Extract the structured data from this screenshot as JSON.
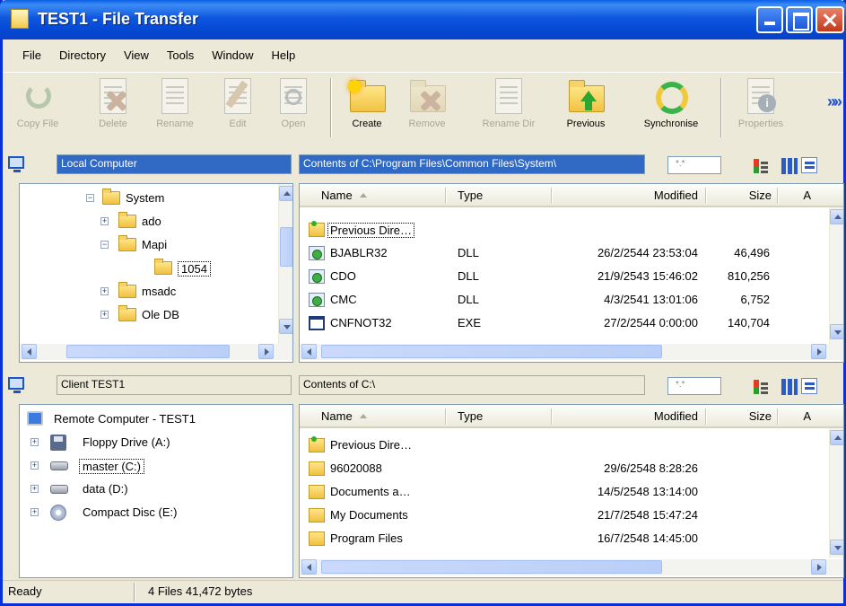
{
  "window": {
    "title": "TEST1 - File Transfer"
  },
  "menu": [
    "File",
    "Directory",
    "View",
    "Tools",
    "Window",
    "Help"
  ],
  "toolbar": {
    "copy_file": "Copy File",
    "delete": "Delete",
    "rename": "Rename",
    "edit": "Edit",
    "open": "Open",
    "create": "Create",
    "remove": "Remove",
    "rename_dir": "Rename Dir",
    "previous": "Previous",
    "synchronise": "Synchronise",
    "properties": "Properties"
  },
  "local": {
    "header": "Local Computer",
    "contents": "Contents of C:\\Program Files\\Common Files\\System\\",
    "filter": "*.*",
    "tree": [
      "System",
      "ado",
      "Mapi",
      "1054",
      "msadc",
      "Ole DB"
    ],
    "columns": {
      "name": "Name",
      "type": "Type",
      "modified": "Modified",
      "size": "Size",
      "attr": "A"
    },
    "rows": [
      {
        "name": "Previous Dire…",
        "type": "",
        "modified": "",
        "size": ""
      },
      {
        "name": "BJABLR32",
        "type": "DLL",
        "modified": "26/2/2544 23:53:04",
        "size": "46,496"
      },
      {
        "name": "CDO",
        "type": "DLL",
        "modified": "21/9/2543 15:46:02",
        "size": "810,256"
      },
      {
        "name": "CMC",
        "type": "DLL",
        "modified": "4/3/2541 13:01:06",
        "size": "6,752"
      },
      {
        "name": "CNFNOT32",
        "type": "EXE",
        "modified": "27/2/2544 0:00:00",
        "size": "140,704"
      }
    ]
  },
  "client": {
    "header": "Client TEST1",
    "contents": "Contents of C:\\",
    "filter": "*.*",
    "tree": [
      "Remote Computer - TEST1",
      "Floppy Drive (A:)",
      "master (C:)",
      "data (D:)",
      "Compact Disc (E:)"
    ],
    "columns": {
      "name": "Name",
      "type": "Type",
      "modified": "Modified",
      "size": "Size",
      "attr": "A"
    },
    "rows": [
      {
        "name": "Previous Dire…",
        "modified": ""
      },
      {
        "name": "96020088",
        "modified": "29/6/2548 8:28:26"
      },
      {
        "name": "Documents a…",
        "modified": "14/5/2548 13:14:00"
      },
      {
        "name": "My Documents",
        "modified": "21/7/2548 15:47:24"
      },
      {
        "name": "Program Files",
        "modified": "16/7/2548 14:45:00"
      }
    ]
  },
  "status": {
    "ready": "Ready",
    "files": "4 Files 41,472 bytes"
  }
}
